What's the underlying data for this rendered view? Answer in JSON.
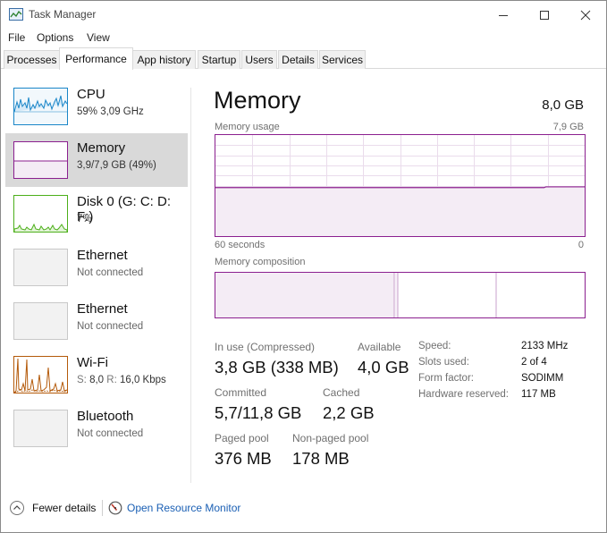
{
  "window": {
    "title": "Task Manager"
  },
  "menu": {
    "items": [
      "File",
      "Options",
      "View"
    ]
  },
  "tabs": [
    "Processes",
    "Performance",
    "App history",
    "Startup",
    "Users",
    "Details",
    "Services"
  ],
  "active_tab": "Performance",
  "devices": [
    {
      "name": "CPU",
      "sub1": "59%  3,09 GHz"
    },
    {
      "name": "Memory",
      "sub1": "3,9/7,9 GB (49%)"
    },
    {
      "name": "Disk 0 (G: C: D: F:)",
      "sub1": "7%"
    },
    {
      "name": "Ethernet",
      "sub1": "Not connected"
    },
    {
      "name": "Ethernet",
      "sub1": "Not connected"
    },
    {
      "name": "Wi-Fi",
      "sub_s_label": "S:",
      "sub_s_value": "8,0",
      "sub_r_label": "R:",
      "sub_r_value": "16,0 Kbps"
    },
    {
      "name": "Bluetooth",
      "sub1": "Not connected"
    }
  ],
  "memory": {
    "title": "Memory",
    "total": "8,0 GB",
    "usage_label": "Memory usage",
    "usage_max": "7,9 GB",
    "axis_left": "60 seconds",
    "axis_right": "0",
    "usage_fraction": 0.48,
    "composition_label": "Memory composition",
    "in_use_label": "In use (Compressed)",
    "in_use_value": "3,8 GB (338 MB)",
    "available_label": "Available",
    "available_value": "4,0 GB",
    "committed_label": "Committed",
    "committed_value": "5,7/11,8 GB",
    "cached_label": "Cached",
    "cached_value": "2,2 GB",
    "paged_label": "Paged pool",
    "paged_value": "376 MB",
    "nonpaged_label": "Non-paged pool",
    "nonpaged_value": "178 MB",
    "details": [
      {
        "label": "Speed:",
        "value": "2133 MHz"
      },
      {
        "label": "Slots used:",
        "value": "2 of 4"
      },
      {
        "label": "Form factor:",
        "value": "SODIMM"
      },
      {
        "label": "Hardware reserved:",
        "value": "117 MB"
      }
    ]
  },
  "bottom": {
    "fewer_details": "Fewer details",
    "open_resource_monitor": "Open Resource Monitor"
  },
  "colors": {
    "memory_accent": "#8b1f8f",
    "cpu_accent": "#1a86c8",
    "disk_accent": "#4caf1a",
    "wifi_accent": "#b45a0a",
    "link": "#1a5fb4"
  }
}
